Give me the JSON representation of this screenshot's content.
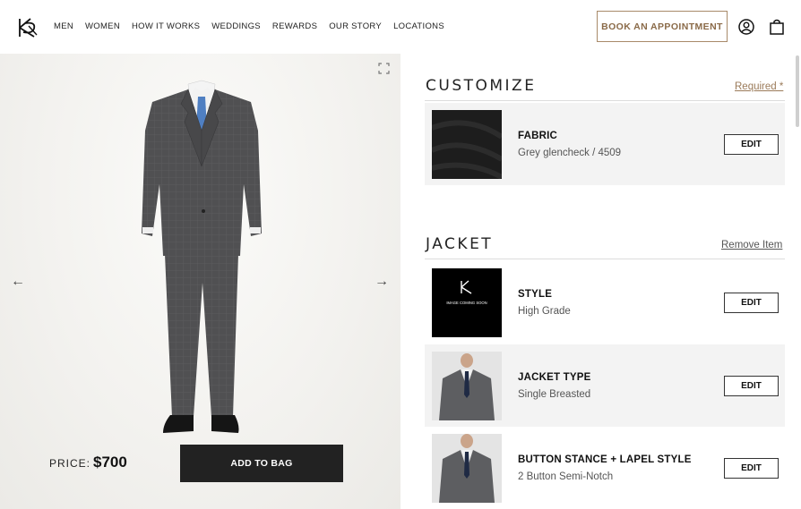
{
  "header": {
    "nav": [
      "MEN",
      "WOMEN",
      "HOW IT WORKS",
      "WEDDINGS",
      "REWARDS",
      "OUR STORY",
      "LOCATIONS"
    ],
    "book_label": "BOOK AN APPOINTMENT",
    "icons": [
      "logo-monogram-icon",
      "account-icon",
      "shopping-bag-icon"
    ]
  },
  "product": {
    "price_label": "PRICE:",
    "price_value": "$700",
    "add_to_bag": "ADD TO BAG",
    "prev_arrow": "←",
    "next_arrow": "→"
  },
  "customize": {
    "title": "CUSTOMIZE",
    "link": "Required *",
    "items": [
      {
        "title": "FABRIC",
        "value": "Grey glencheck / 4509",
        "edit": "EDIT"
      }
    ]
  },
  "jacket": {
    "title": "JACKET",
    "link": "Remove Item",
    "items": [
      {
        "title": "STYLE",
        "value": "High Grade",
        "edit": "EDIT",
        "thumb_text": "IMAGE COMING SOON"
      },
      {
        "title": "JACKET TYPE",
        "value": "Single Breasted",
        "edit": "EDIT"
      },
      {
        "title": "BUTTON STANCE + LAPEL STYLE",
        "value": "2 Button Semi-Notch",
        "edit": "EDIT"
      }
    ]
  },
  "colors": {
    "accent": "#9b7b5a",
    "button_dark": "#222222",
    "row_grey": "#f3f3f3"
  }
}
